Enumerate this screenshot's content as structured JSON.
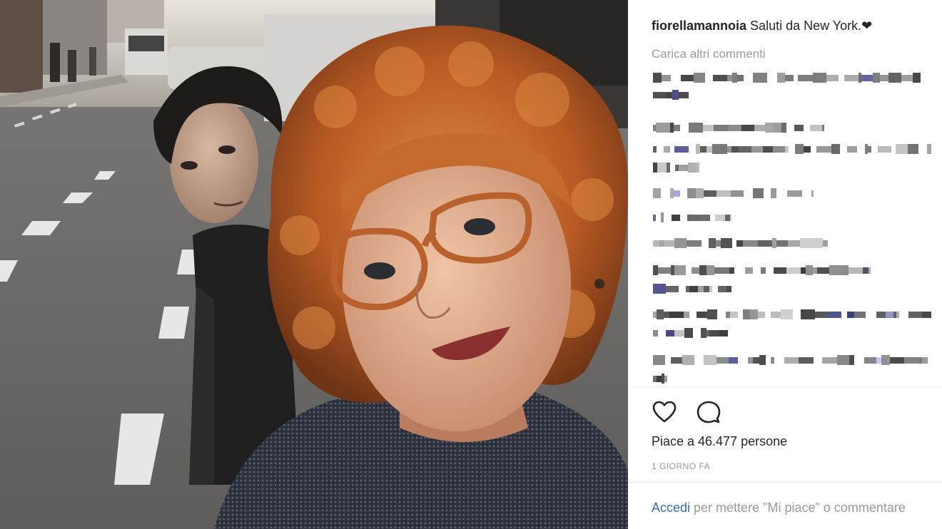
{
  "post": {
    "username": "fiorellamannoia",
    "caption": "Saluti da New York.",
    "caption_heart": "❤",
    "load_more": "Carica altri commenti",
    "likes": "Piace a 46.477 persone",
    "time": "1 GIORNO FA",
    "login_link": "Accedi",
    "login_text": " per mettere \"Mi piace\" o commentare"
  },
  "icons": {
    "like": "heart-outline-icon",
    "comment": "speech-bubble-icon"
  },
  "colors": {
    "link": "#3b6bb5",
    "muted": "#9a9a9a",
    "text": "#262626",
    "hair": "#c8662a",
    "glasses": "#b8612c"
  }
}
